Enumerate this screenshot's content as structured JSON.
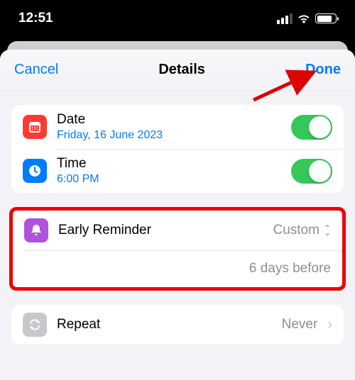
{
  "statusBar": {
    "time": "12:51"
  },
  "nav": {
    "cancel": "Cancel",
    "title": "Details",
    "done": "Done"
  },
  "rows": {
    "date": {
      "title": "Date",
      "value": "Friday, 16 June 2023",
      "enabled": true
    },
    "time": {
      "title": "Time",
      "value": "6:00 PM",
      "enabled": true
    },
    "earlyReminder": {
      "title": "Early Reminder",
      "value": "Custom",
      "detail": "6 days before"
    },
    "repeat": {
      "title": "Repeat",
      "value": "Never"
    }
  }
}
